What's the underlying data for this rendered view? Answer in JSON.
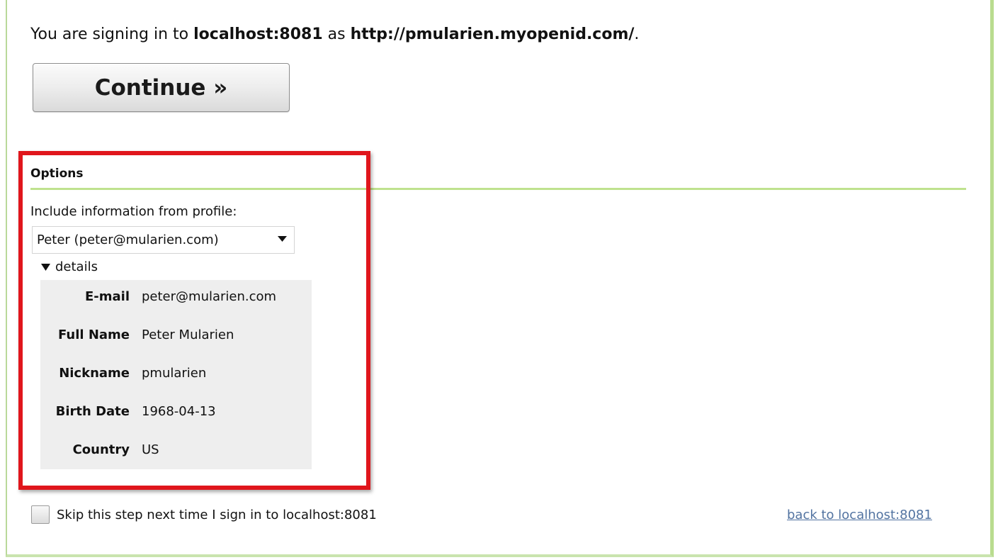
{
  "intro": {
    "prefix": "You are signing in to",
    "site": "localhost:8081",
    "middle": "as",
    "identity": "http://pmularien.myopenid.com/",
    "suffix": "."
  },
  "continue_label": "Continue »",
  "options": {
    "heading": "Options",
    "include_label": "Include information from profile:",
    "profile_selected": "Peter (peter@mularien.com)",
    "details_label": "details",
    "details": [
      {
        "key": "E-mail",
        "value": "peter@mularien.com"
      },
      {
        "key": "Full Name",
        "value": "Peter Mularien"
      },
      {
        "key": "Nickname",
        "value": "pmularien"
      },
      {
        "key": "Birth Date",
        "value": "1968-04-13"
      },
      {
        "key": "Country",
        "value": "US"
      }
    ]
  },
  "skip": {
    "label": "Skip this step next time I sign in to localhost:8081",
    "checked": false
  },
  "back_link": "back to localhost:8081",
  "colors": {
    "accent_green": "#bfe28f",
    "highlight_red": "#e0161c",
    "link_blue": "#5273a1",
    "details_bg": "#eeeeee"
  }
}
